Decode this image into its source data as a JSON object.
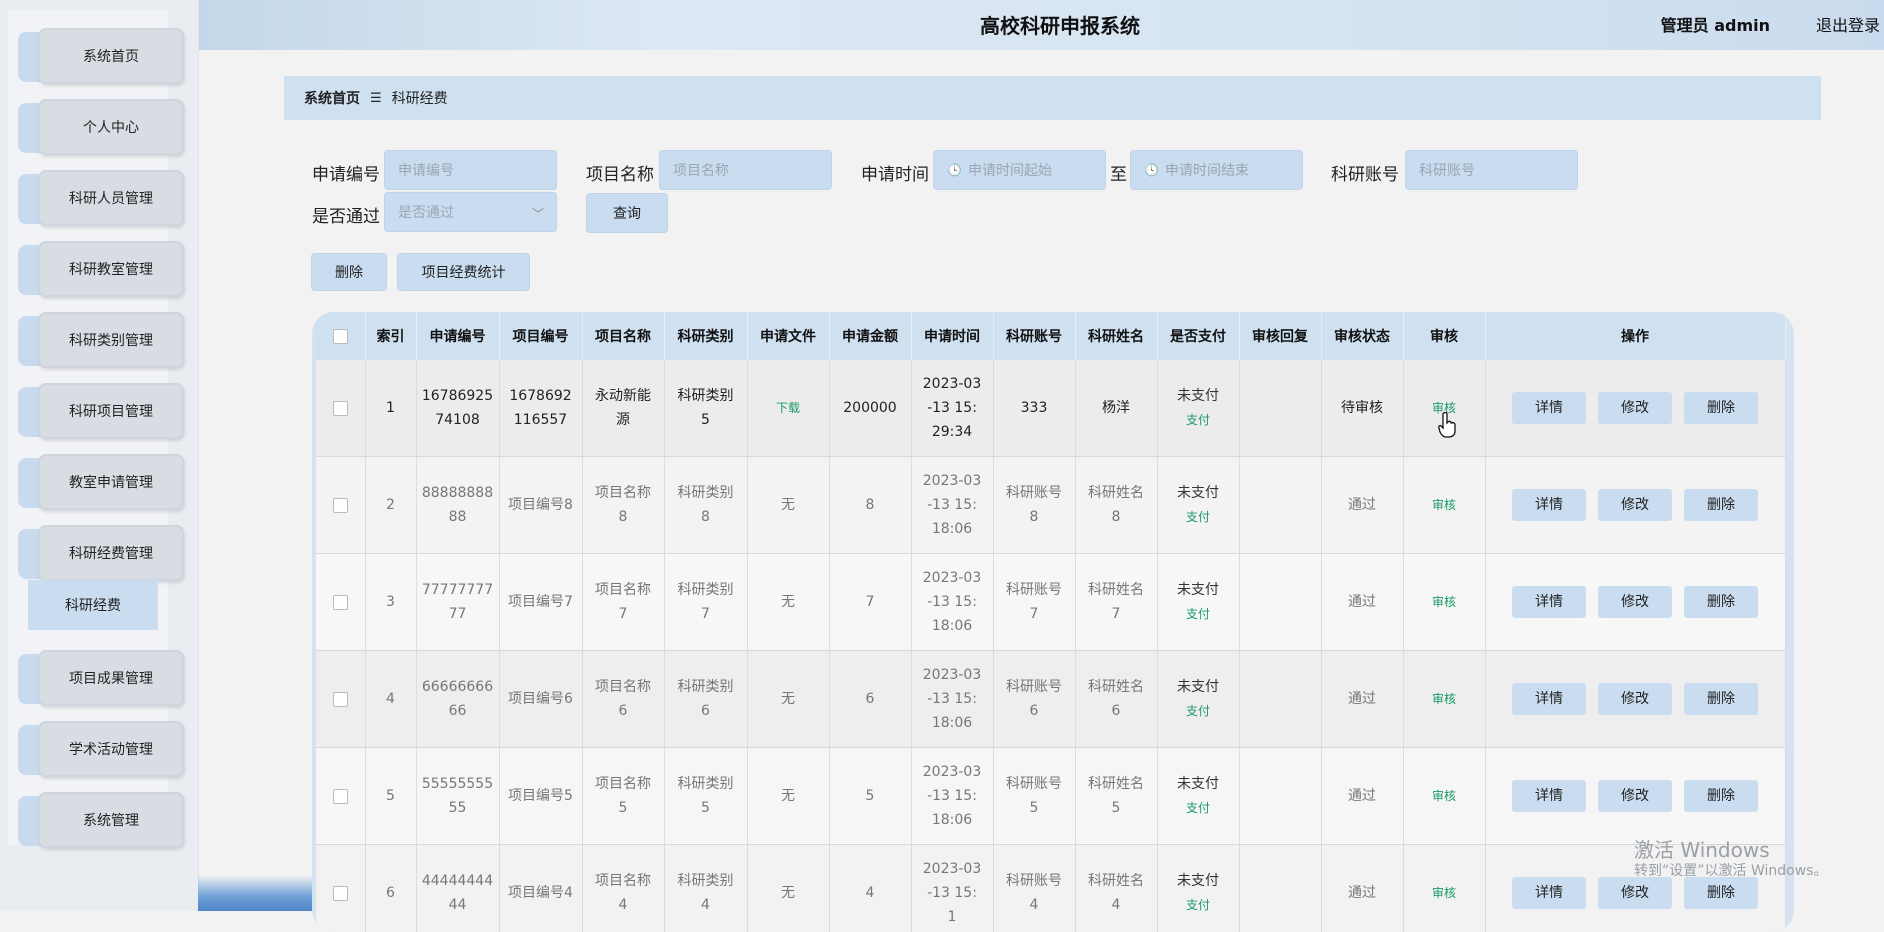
{
  "header": {
    "title": "高校科研申报系统",
    "user": "管理员 admin",
    "logout": "退出登录"
  },
  "sidebar": {
    "items": [
      {
        "label": "系统首页"
      },
      {
        "label": "个人中心"
      },
      {
        "label": "科研人员管理"
      },
      {
        "label": "科研教室管理"
      },
      {
        "label": "科研类别管理"
      },
      {
        "label": "科研项目管理"
      },
      {
        "label": "教室申请管理"
      },
      {
        "label": "科研经费管理"
      },
      {
        "label": "项目成果管理"
      },
      {
        "label": "学术活动管理"
      },
      {
        "label": "系统管理"
      }
    ],
    "submenu": "科研经费"
  },
  "breadcrumb": {
    "home": "系统首页",
    "sep": "☰",
    "current": "科研经费"
  },
  "search": {
    "apply_no_label": "申请编号",
    "apply_no_placeholder": "申请编号",
    "project_name_label": "项目名称",
    "project_name_placeholder": "项目名称",
    "apply_time_label": "申请时间",
    "start_placeholder": "申请时间起始",
    "to_label": "至",
    "end_placeholder": "申请时间结束",
    "account_label": "科研账号",
    "account_placeholder": "科研账号",
    "passed_label": "是否通过",
    "passed_placeholder": "是否通过",
    "query_button": "查询"
  },
  "toolbar": {
    "delete": "删除",
    "stats": "项目经费统计"
  },
  "table": {
    "columns": [
      "索引",
      "申请编号",
      "项目编号",
      "项目名称",
      "科研类别",
      "申请文件",
      "申请金额",
      "申请时间",
      "科研账号",
      "科研姓名",
      "是否支付",
      "审核回复",
      "审核状态",
      "审核",
      "操作"
    ],
    "rows": [
      {
        "index": "1",
        "apply_no": "1678692574108",
        "project_no": "1678692116557",
        "project_name": "永动新能源",
        "category": "科研类别5",
        "file": "下载",
        "amount": "200000",
        "time": "2023-03-13 15:29:34",
        "account": "333",
        "name": "杨洋",
        "paid": "未支付",
        "pay": "支付",
        "reply": "",
        "status": "待审核",
        "audit": "审核"
      },
      {
        "index": "2",
        "apply_no": "8888888888",
        "project_no": "项目编号8",
        "project_name": "项目名称8",
        "category": "科研类别8",
        "file": "无",
        "amount": "8",
        "time": "2023-03-13 15:18:06",
        "account": "科研账号8",
        "name": "科研姓名8",
        "paid": "未支付",
        "pay": "支付",
        "reply": "",
        "status": "通过",
        "audit": "审核"
      },
      {
        "index": "3",
        "apply_no": "7777777777",
        "project_no": "项目编号7",
        "project_name": "项目名称7",
        "category": "科研类别7",
        "file": "无",
        "amount": "7",
        "time": "2023-03-13 15:18:06",
        "account": "科研账号7",
        "name": "科研姓名7",
        "paid": "未支付",
        "pay": "支付",
        "reply": "",
        "status": "通过",
        "audit": "审核"
      },
      {
        "index": "4",
        "apply_no": "6666666666",
        "project_no": "项目编号6",
        "project_name": "项目名称6",
        "category": "科研类别6",
        "file": "无",
        "amount": "6",
        "time": "2023-03-13 15:18:06",
        "account": "科研账号6",
        "name": "科研姓名6",
        "paid": "未支付",
        "pay": "支付",
        "reply": "",
        "status": "通过",
        "audit": "审核"
      },
      {
        "index": "5",
        "apply_no": "5555555555",
        "project_no": "项目编号5",
        "project_name": "项目名称5",
        "category": "科研类别5",
        "file": "无",
        "amount": "5",
        "time": "2023-03-13 15:18:06",
        "account": "科研账号5",
        "name": "科研姓名5",
        "paid": "未支付",
        "pay": "支付",
        "reply": "",
        "status": "通过",
        "audit": "审核"
      },
      {
        "index": "6",
        "apply_no": "4444444444",
        "project_no": "项目编号4",
        "project_name": "项目名称4",
        "category": "科研类别4",
        "file": "无",
        "amount": "4",
        "time": "2023-03-13 15:1",
        "account": "科研账号4",
        "name": "科研姓名4",
        "paid": "未支付",
        "pay": "支付",
        "reply": "",
        "status": "通过",
        "audit": "审核"
      }
    ],
    "actions": {
      "detail": "详情",
      "edit": "修改",
      "delete": "删除"
    }
  },
  "watermark": {
    "line1": "激活 Windows",
    "line2": "转到“设置”以激活 Windows。"
  },
  "colors": {
    "accent": "#c9dcf0",
    "header": "#cfe0f1",
    "pay_green": "#1a9a66"
  }
}
